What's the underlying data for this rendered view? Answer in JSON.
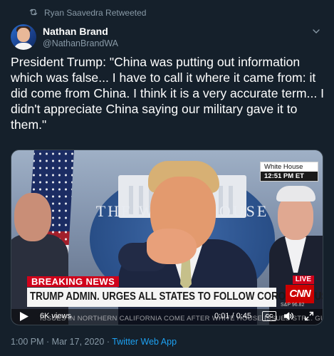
{
  "retweet": {
    "label": "Ryan Saavedra Retweeted",
    "icon": "retweet-icon"
  },
  "author": {
    "display_name": "Nathan Brand",
    "handle": "@NathanBrandWA"
  },
  "tweet": {
    "text": "President Trump: \"China was putting out information which was false... I have to call it where it came from: it did come from China. I think it is a very accurate term... I didn't appreciate China saying our military gave it to them.\""
  },
  "video": {
    "backdrop_text": "THE WHITE HOUSE",
    "backdrop_fragment": "ON",
    "network_tag": {
      "location": "White House",
      "time": "12:51 PM ET"
    },
    "breaking_label": "BREAKING NEWS",
    "headline": "TRUMP ADMIN. URGES ALL STATES TO FOLLOW CORONAVIRUS GUIDELINES",
    "ticker": "ISSUES IN NORTHERN CALIFORNIA COME AFTER WHITE HOUSE ISSUES STR... GUIDELINES",
    "live_label": "LIVE",
    "network_logo": "CNN",
    "markets_text": "S&P 96.82",
    "views": "6K views",
    "time": "0:01 / 0:45",
    "cc_label": "CC"
  },
  "footer": {
    "timestamp": "1:00 PM · Mar 17, 2020",
    "separator": "·",
    "source": "Twitter Web App"
  },
  "colors": {
    "background": "#15202b",
    "secondary_text": "#8899a6",
    "link": "#1da1f2",
    "breaking_red": "#d0021b"
  }
}
